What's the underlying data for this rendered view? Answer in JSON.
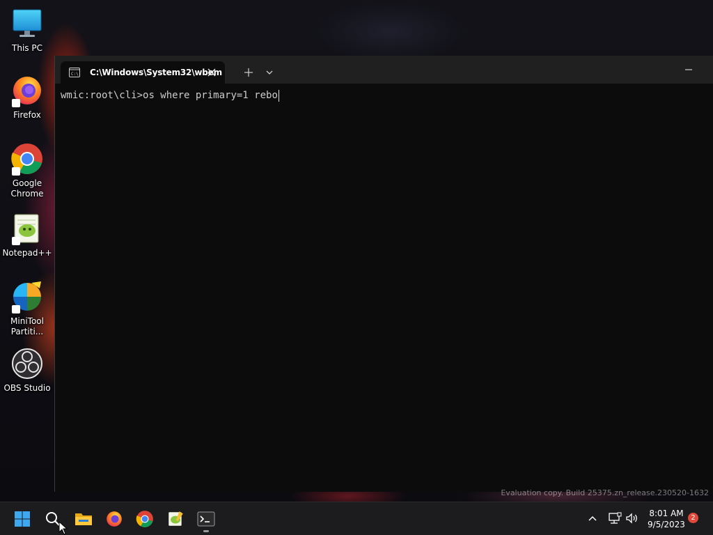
{
  "desktop": {
    "icons": [
      {
        "label": "This PC",
        "icon": "this-pc-icon"
      },
      {
        "label": "Firefox",
        "icon": "firefox-icon"
      },
      {
        "label": "Google\nChrome",
        "icon": "chrome-icon"
      },
      {
        "label": "Notepad++",
        "icon": "notepad-plus-plus-icon"
      },
      {
        "label": "MiniTool\nPartiti...",
        "icon": "minitool-partition-icon"
      },
      {
        "label": "OBS Studio",
        "icon": "obs-studio-icon"
      }
    ]
  },
  "terminal": {
    "tab_title": "C:\\Windows\\System32\\wbem",
    "prompt": "wmic:root\\cli>",
    "command": "os where primary=1 rebo",
    "background_color": "#0c0c0c",
    "titlebar_color": "#202020"
  },
  "watermark": "Evaluation copy. Build 25375.zn_release.230520-1632",
  "taskbar": {
    "items": [
      {
        "name": "start",
        "icon": "windows-start-icon"
      },
      {
        "name": "search",
        "icon": "search-icon"
      },
      {
        "name": "file-explorer",
        "icon": "folder-icon"
      },
      {
        "name": "firefox",
        "icon": "firefox-icon"
      },
      {
        "name": "chrome",
        "icon": "chrome-icon"
      },
      {
        "name": "notepad-plus-plus",
        "icon": "notepad-plus-plus-icon"
      },
      {
        "name": "terminal",
        "icon": "terminal-icon",
        "active": true
      }
    ],
    "tray": {
      "overflow_icon": "chevron-up-icon",
      "network_icon": "network-icon",
      "volume_icon": "speaker-icon"
    },
    "clock": {
      "time": "8:01 AM",
      "date": "9/5/2023"
    },
    "notification_count": "2"
  }
}
